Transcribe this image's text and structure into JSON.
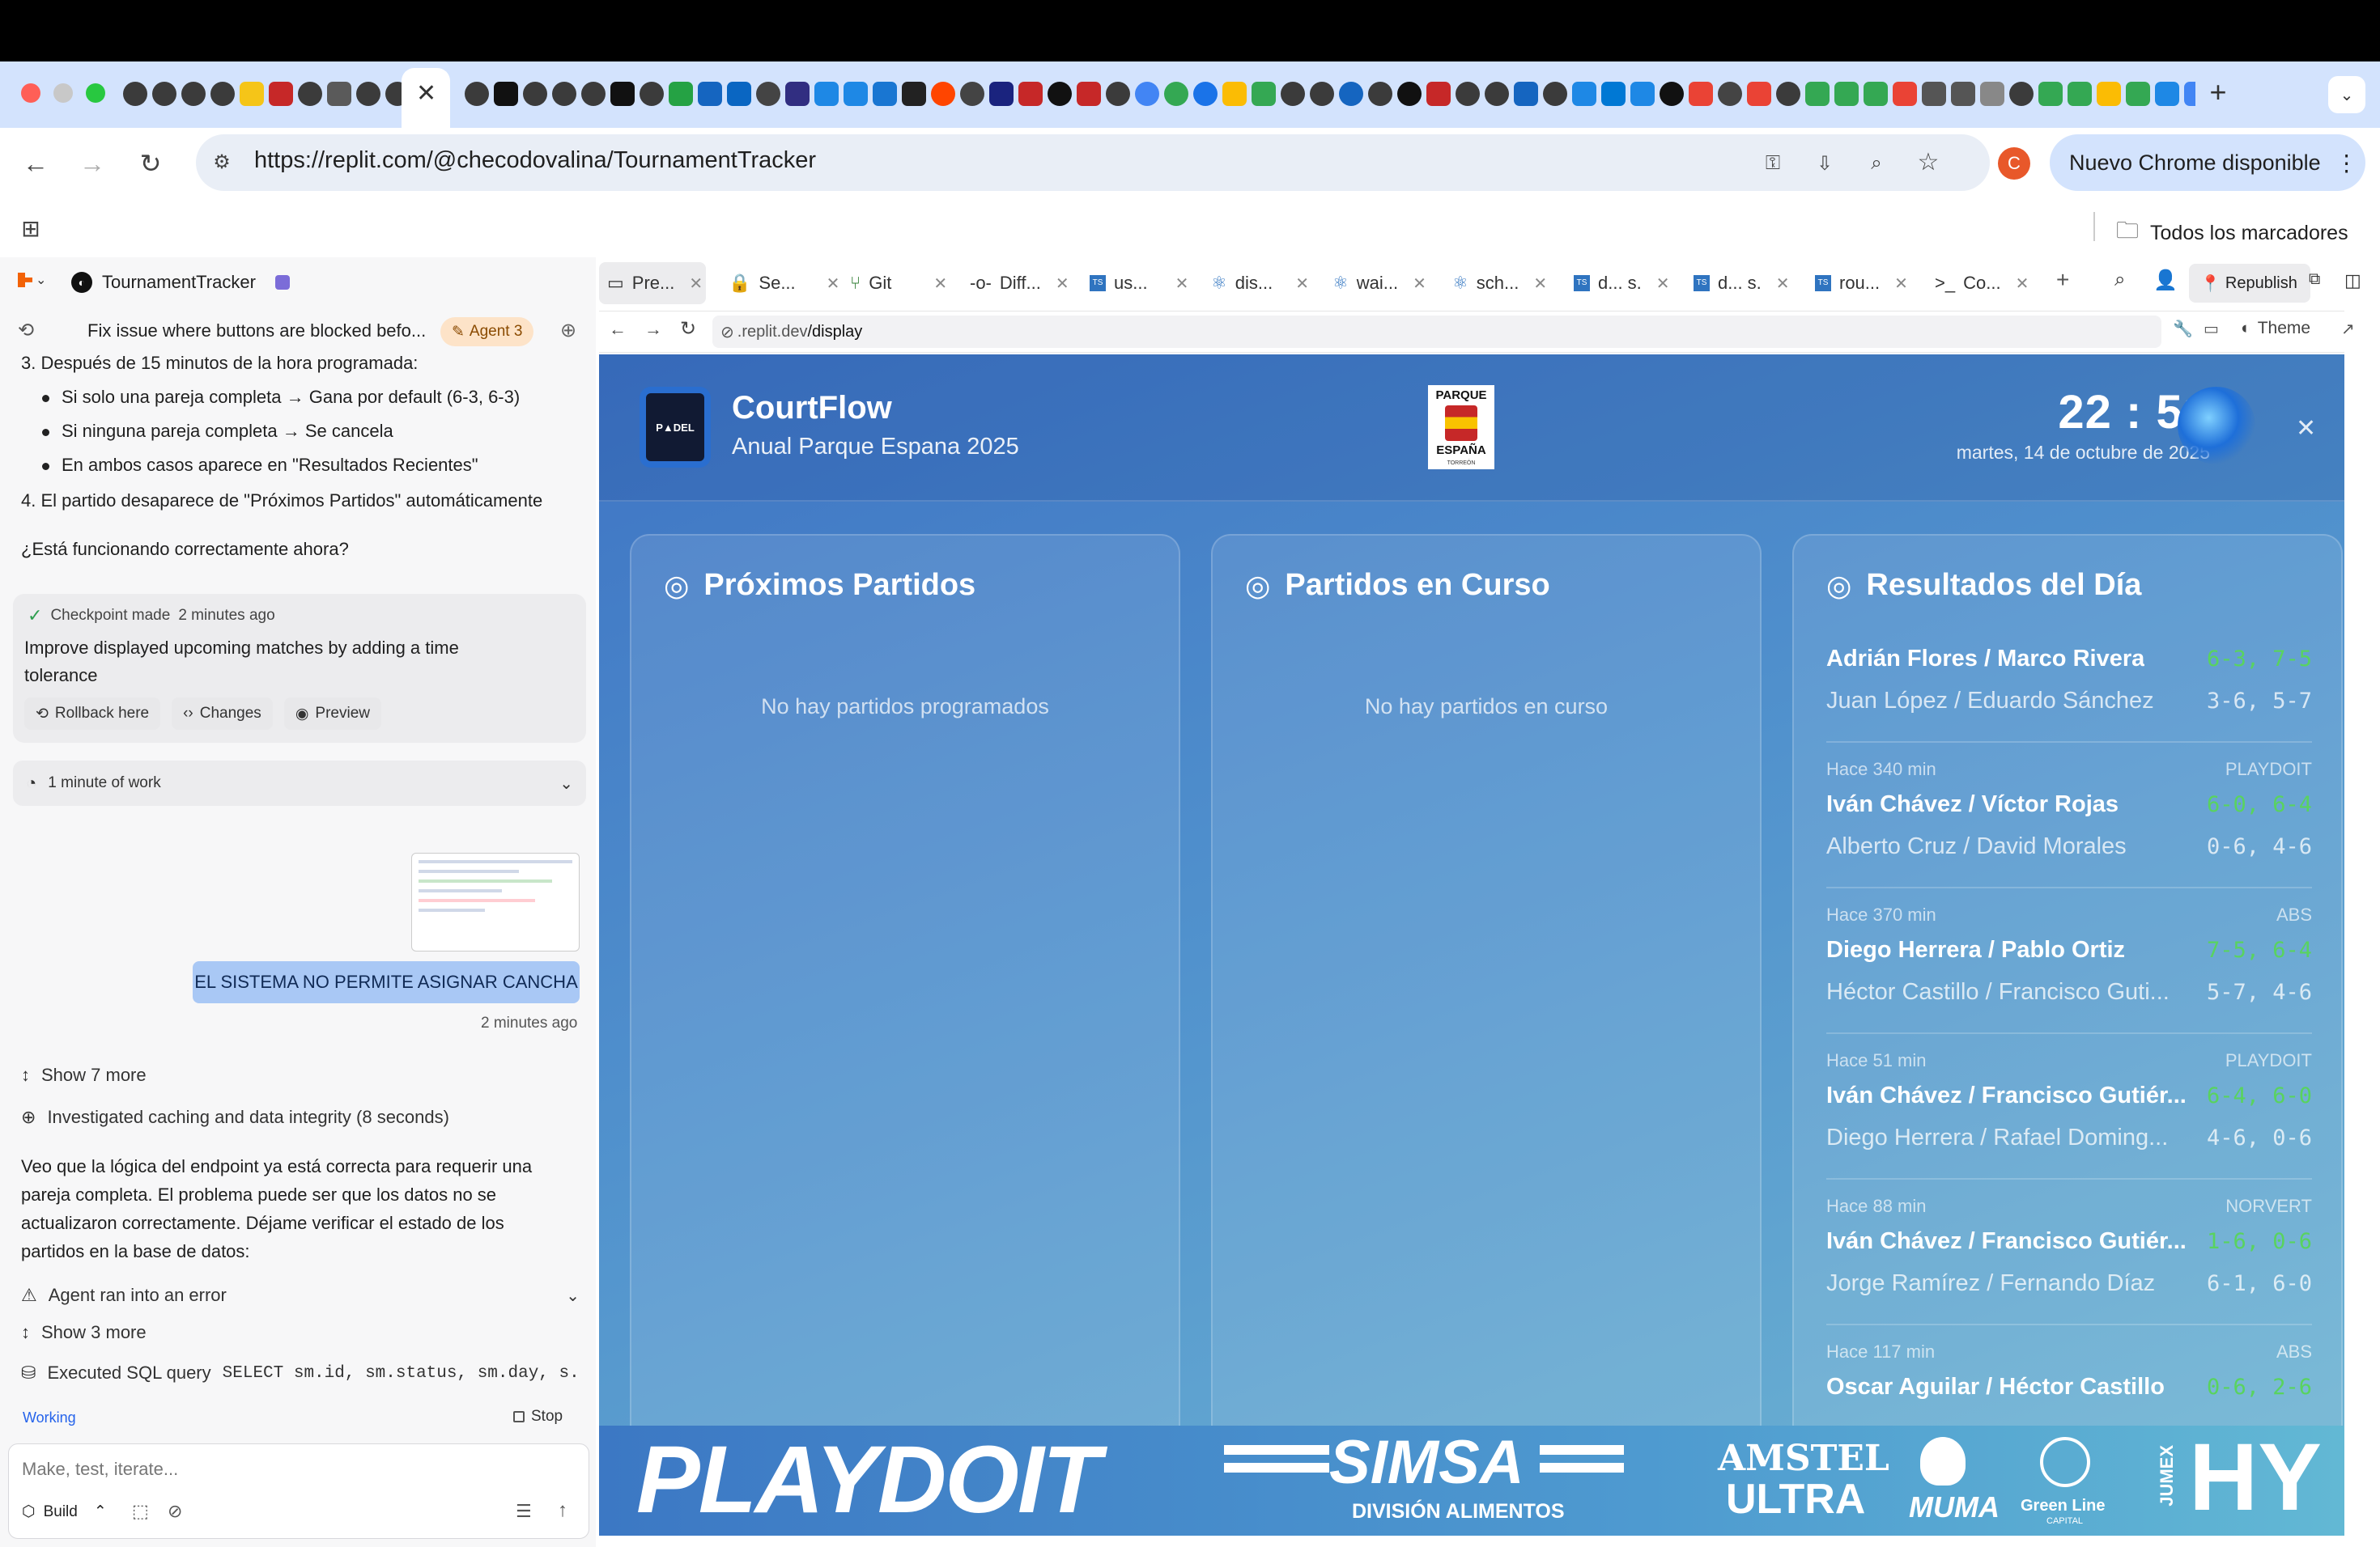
{
  "browser": {
    "address": "https://replit.com/@checodovalina/TournamentTracker",
    "update_label": "Nuevo Chrome disponible",
    "profile_initial": "C",
    "bookmarks_label": "Todos los marcadores",
    "colors": {
      "tabstrip": "#d3e3fd",
      "profile": "#e8582a"
    }
  },
  "sidebar": {
    "project_name": "TournamentTracker",
    "thread_title": "Fix issue where buttons are blocked befo...",
    "agent_badge": "Agent 3",
    "messages": {
      "step3": "3. Después de 15 minutos de la hora programada:",
      "b1": "Si solo una pareja completa → Gana por default (6-3, 6-3)",
      "b2": "Si ninguna pareja completa → Se cancela",
      "b3": "En ambos casos aparece en \"Resultados Recientes\"",
      "step4": "4. El partido desaparece de \"Próximos Partidos\" automáticamente",
      "question": "¿Está funcionando correctamente ahora?"
    },
    "checkpoint": {
      "label": "Checkpoint made",
      "time": "2 minutes ago",
      "text": "Improve displayed upcoming matches by adding a time tolerance",
      "rollback": "Rollback here",
      "changes": "Changes",
      "preview": "Preview"
    },
    "work_label": "1 minute of work",
    "user_message": "EL SISTEMA NO PERMITE ASIGNAR CANCHA",
    "user_time": "2 minutes ago",
    "show_more_1": "Show 7 more",
    "investigated": "Investigated caching and data integrity (8 seconds)",
    "agent_text": "Veo que la lógica del endpoint ya está correcta para requerir una pareja completa. El problema puede ser que los datos no se actualizaron correctamente. Déjame verificar el estado de los partidos en la base de datos:",
    "error": "Agent ran into an error",
    "show_more_2": "Show 3 more",
    "sql_label": "Executed SQL query",
    "sql_query": "SELECT sm.id, sm.status, sm.day, s...",
    "status": "Working",
    "stop": "Stop",
    "input_placeholder": "Make, test, iterate...",
    "build": "Build"
  },
  "workspace": {
    "tabs": [
      "Pre...",
      "Se...",
      "Git",
      "Diff...",
      "us...",
      "dis...",
      "wai...",
      "sch...",
      "d... s.",
      "d... s.",
      "rou...",
      "Co..."
    ],
    "republish": "Republish",
    "url_host": ".replit.dev",
    "url_path": "/display",
    "theme": "Theme"
  },
  "display": {
    "app_name": "CourtFlow",
    "tournament": "Anual Parque Espana 2025",
    "logo_text": [
      "PARQUE",
      "ESPAÑA",
      "TORREÓN"
    ],
    "time": "22 : 51",
    "date": "martes, 14 de octubre de 2025",
    "upcoming": {
      "title": "Próximos Partidos",
      "empty": "No hay partidos programados"
    },
    "live": {
      "title": "Partidos en Curso",
      "empty": "No hay partidos en curso"
    },
    "results": {
      "title": "Resultados del Día",
      "items": [
        {
          "meta": "",
          "sponsor": "",
          "winner": "Adrián Flores / Marco Rivera",
          "winner_score": "6-3, 7-5",
          "loser": "Juan López / Eduardo Sánchez",
          "loser_score": "3-6, 5-7"
        },
        {
          "meta": "Hace 340 min",
          "sponsor": "PLAYDOIT",
          "winner": "Iván Chávez / Víctor Rojas",
          "winner_score": "6-0, 6-4",
          "loser": "Alberto Cruz / David Morales",
          "loser_score": "0-6, 4-6"
        },
        {
          "meta": "Hace 370 min",
          "sponsor": "ABS",
          "winner": "Diego Herrera / Pablo Ortiz",
          "winner_score": "7-5, 6-4",
          "loser": "Héctor Castillo / Francisco Guti...",
          "loser_score": "5-7, 4-6"
        },
        {
          "meta": "Hace 51 min",
          "sponsor": "PLAYDOIT",
          "winner": "Iván Chávez / Francisco Gutiér...",
          "winner_score": "6-4, 6-0",
          "loser": "Diego Herrera / Rafael Doming...",
          "loser_score": "4-6, 0-6"
        },
        {
          "meta": "Hace 88 min",
          "sponsor": "NORVERT",
          "winner": "Iván Chávez / Francisco Gutiér...",
          "winner_score": "1-6, 0-6",
          "loser": "Jorge Ramírez / Fernando Díaz",
          "loser_score": "6-1, 6-0"
        },
        {
          "meta": "Hace 117 min",
          "sponsor": "ABS",
          "winner": "Oscar Aguilar / Héctor Castillo",
          "winner_score": "0-6, 2-6",
          "loser": "",
          "loser_score": ""
        }
      ]
    },
    "sponsors": {
      "playdoit": "PLAYDOIT",
      "simsa": "SIMSA",
      "simsa_sub": "DIVISIÓN ALIMENTOS",
      "amstel": "AMSTEL",
      "ultra": "ULTRA",
      "muma": "MUMA",
      "greenline": "Green Line",
      "greenline_sub": "CAPITAL",
      "jumex": "JUMEX",
      "hy": "HY"
    },
    "colors": {
      "win_score": "#59d35f",
      "gradient_start": "#3e74c4",
      "gradient_end": "#6fb6d3"
    }
  }
}
